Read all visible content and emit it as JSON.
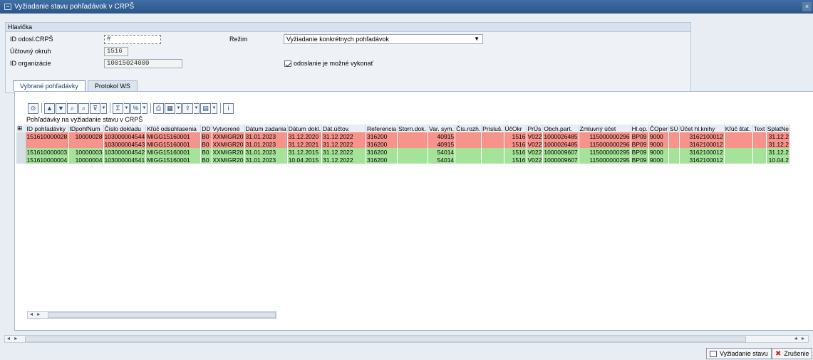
{
  "window": {
    "title": "Vyžiadanie stavu pohľadávok v CRPŠ",
    "close_label": "×"
  },
  "header": {
    "group_title": "Hlavička",
    "fields": {
      "id_odosl_label": "ID odosl.CRPŠ",
      "id_odosl_value": "#",
      "uctovny_okruh_label": "Účtovný okruh",
      "uctovny_okruh_value": "1516",
      "id_organizacie_label": "ID organizácie",
      "id_organizacie_value": "10015024000",
      "rezim_label": "Režim",
      "rezim_value": "Vyžiadanie konkrétnych pohľadávok",
      "status_text": "odoslanie je možné vykonať"
    }
  },
  "tabs": [
    {
      "label": "Vybrané pohľadávky",
      "active": true
    },
    {
      "label": "Protokol WS",
      "active": false
    }
  ],
  "grid": {
    "title": "Pohľadávky na vyžiadanie stavu v CRPŠ",
    "columns": [
      "ID pohľadávky",
      "IDpohľNum",
      "Číslo dokladu",
      "Kľúč odsúhlasenia",
      "DD",
      "Vytvorené",
      "Dátum zadania",
      "Dátum dokl.",
      "Dát.účtov.",
      "Referencia",
      "Storn.dok.",
      "Var. sym.",
      "Čís.rozh.",
      "Prísluš.",
      "ÚčOkr",
      "PrÚs",
      "Obch.part.",
      "Zmluvný účet",
      "Hl.op.",
      "ČOper",
      "SÚ",
      "Účet hl.knihy",
      "Kľúč štat.",
      "Text",
      "SplatNe"
    ],
    "rows": [
      {
        "status": "red",
        "cells": [
          "151610000028",
          "10000028",
          "103000004544",
          "MIGG15160001",
          "B0",
          "XXMIGR20",
          "31.01.2023",
          "31.12.2020",
          "31.12.2022",
          "316200",
          "",
          "40915",
          "",
          "",
          "1516",
          "V022",
          "1000026485",
          "115000000296",
          "BP09",
          "9000",
          "",
          "3162100012",
          "",
          "",
          "31.12.2"
        ]
      },
      {
        "status": "red",
        "cells": [
          "",
          "",
          "103000004543",
          "MIGG15160001",
          "B0",
          "XXMIGR20",
          "31.01.2023",
          "31.12.2021",
          "31.12.2022",
          "316200",
          "",
          "40915",
          "",
          "",
          "1516",
          "V022",
          "1000026485",
          "115000000296",
          "BP09",
          "9000",
          "",
          "3162100012",
          "",
          "",
          "31.12.2"
        ]
      },
      {
        "status": "green",
        "cells": [
          "151610000003",
          "10000003",
          "103000004542",
          "MIGG15160001",
          "B0",
          "XXMIGR20",
          "31.01.2023",
          "31.12.2015",
          "31.12.2022",
          "316200",
          "",
          "54014",
          "",
          "",
          "1516",
          "V022",
          "1000009607",
          "115000000295",
          "BP09",
          "9000",
          "",
          "3162100012",
          "",
          "",
          "31.12.2"
        ]
      },
      {
        "status": "green",
        "cells": [
          "151610000004",
          "10000004",
          "103000004541",
          "MIGG15160001",
          "B0",
          "XXMIGR20",
          "31.01.2023",
          "10.04.2015",
          "31.12.2022",
          "316200",
          "",
          "54014",
          "",
          "",
          "1516",
          "V022",
          "1000009607",
          "115000000295",
          "BP09",
          "9000",
          "",
          "3162100012",
          "",
          "",
          "10.04.2"
        ]
      }
    ]
  },
  "footer": {
    "request_button": "Vyžiadanie stavu",
    "cancel_button": "Zrušenie"
  },
  "colors": {
    "row_error": "#f6938b",
    "row_ok": "#a5e39b",
    "titlebar": "#2c5688"
  }
}
